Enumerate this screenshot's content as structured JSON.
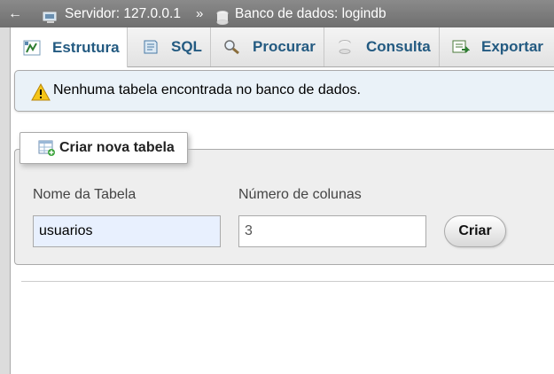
{
  "topbar": {
    "back_label": "←",
    "server_label": "Servidor: 127.0.0.1",
    "separator": "»",
    "database_label": "Banco de dados: logindb"
  },
  "tabs": [
    {
      "label": "Estrutura",
      "icon": "structure-icon",
      "active": true
    },
    {
      "label": "SQL",
      "icon": "sql-icon",
      "active": false
    },
    {
      "label": "Procurar",
      "icon": "search-icon",
      "active": false
    },
    {
      "label": "Consulta",
      "icon": "query-icon",
      "active": false
    },
    {
      "label": "Exportar",
      "icon": "export-icon",
      "active": false
    }
  ],
  "notice": {
    "icon": "warning-icon",
    "message": "Nenhuma tabela encontrada no banco de dados."
  },
  "create_table": {
    "legend": "Criar nova tabela",
    "legend_icon": "new-table-icon",
    "table_name_label": "Nome da Tabela",
    "table_name_value": "usuarios",
    "columns_label": "Número de colunas",
    "columns_value": "3",
    "submit_label": "Criar"
  },
  "colors": {
    "topbar": "#7b7b7b",
    "tab_text": "#235a81",
    "notice_bg": "#eaf2f8",
    "fieldset_bg": "#eeeeee",
    "autofill_bg": "#e8f0fe"
  }
}
